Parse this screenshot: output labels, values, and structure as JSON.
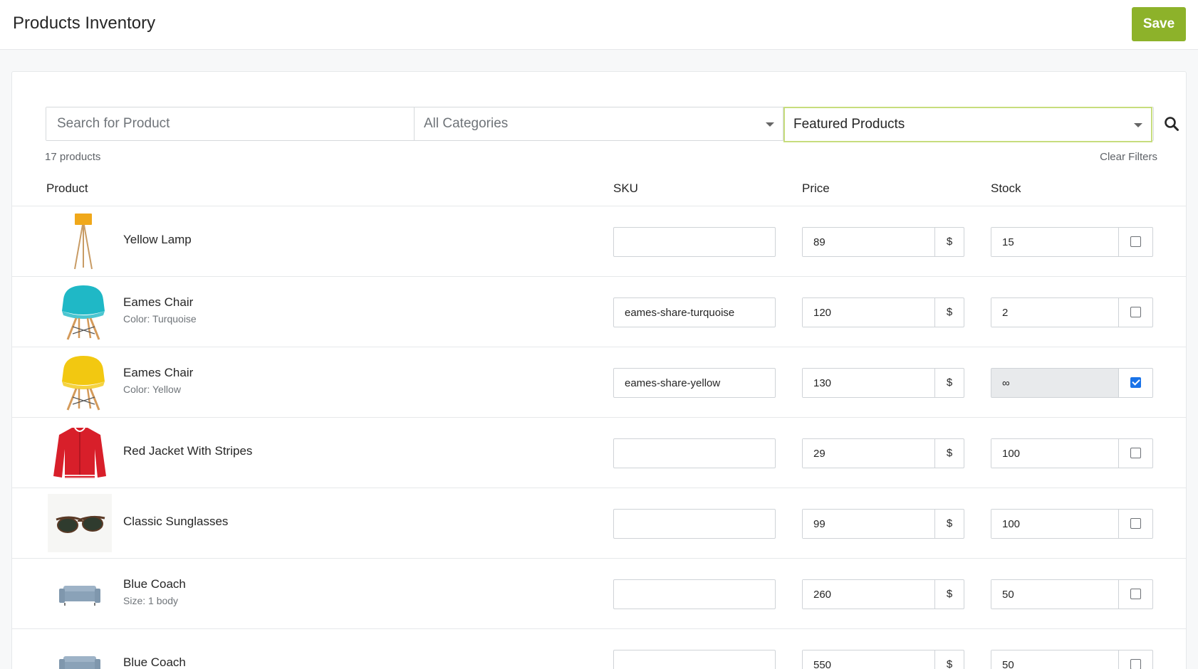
{
  "header": {
    "title": "Products Inventory",
    "save_label": "Save"
  },
  "filters": {
    "search_placeholder": "Search for Product",
    "category": "All Categories",
    "collection": "Featured Products"
  },
  "summary": {
    "count": "17 products",
    "clear": "Clear Filters"
  },
  "columns": {
    "product": "Product",
    "sku": "SKU",
    "price": "Price",
    "stock": "Stock"
  },
  "currency_symbol": "$",
  "products": [
    {
      "name": "Yellow Lamp",
      "variant": "",
      "sku": "",
      "price": "89",
      "stock": "15",
      "unlimited": false,
      "image": "lamp-icon"
    },
    {
      "name": "Eames Chair",
      "variant": "Color: Turquoise",
      "sku": "eames-share-turquoise",
      "price": "120",
      "stock": "2",
      "unlimited": false,
      "image": "chair-icon"
    },
    {
      "name": "Eames Chair",
      "variant": "Color:  Yellow",
      "sku": "eames-share-yellow",
      "price": "130",
      "stock": "∞",
      "unlimited": true,
      "image": "chair-icon"
    },
    {
      "name": "Red Jacket With Stripes",
      "variant": "",
      "sku": "",
      "price": "29",
      "stock": "100",
      "unlimited": false,
      "image": "jacket-icon"
    },
    {
      "name": "Classic Sunglasses",
      "variant": "",
      "sku": "",
      "price": "99",
      "stock": "100",
      "unlimited": false,
      "image": "sunglasses-icon"
    },
    {
      "name": "Blue Coach",
      "variant": "Size: 1 body",
      "sku": "",
      "price": "260",
      "stock": "50",
      "unlimited": false,
      "image": "sofa-icon"
    },
    {
      "name": "Blue Coach",
      "variant": "",
      "sku": "",
      "price": "550",
      "stock": "50",
      "unlimited": false,
      "image": "sofa-icon"
    }
  ],
  "colors": {
    "accent": "#8db22a",
    "checkbox": "#1a73e8",
    "chair_turquoise": "#1fb8c6",
    "chair_yellow": "#f2c811",
    "jacket": "#d81f2a",
    "lamp": "#f0a81a",
    "sofa": "#9eb3c7"
  }
}
